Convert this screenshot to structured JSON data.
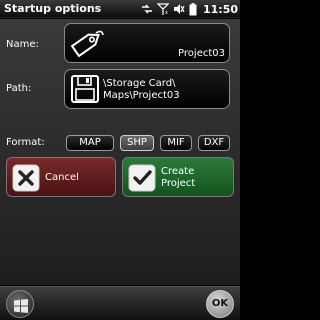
{
  "window": {
    "title": "Startup options",
    "time": "11:50"
  },
  "status_icons": [
    "sync-icon",
    "signal-icon",
    "volume-icon",
    "battery-icon"
  ],
  "name": {
    "label": "Name:",
    "value": "Project03",
    "icon": "tag-icon"
  },
  "path": {
    "label": "Path:",
    "line1": "\\Storage Card\\",
    "line2": "Maps\\Project03",
    "icon": "floppy-disk-icon"
  },
  "format": {
    "label": "Format:",
    "options": [
      "MAP",
      "SHP",
      "MIF",
      "DXF"
    ],
    "selected": "SHP"
  },
  "actions": {
    "cancel_label": "Cancel",
    "create_line1": "Create",
    "create_line2": "Project"
  },
  "bottom": {
    "start_icon": "windows-start-icon",
    "ok_label": "OK"
  },
  "colors": {
    "cancel": "#6a1f1f",
    "create": "#1f6a2b",
    "selected_format": "#5a5a5a"
  }
}
